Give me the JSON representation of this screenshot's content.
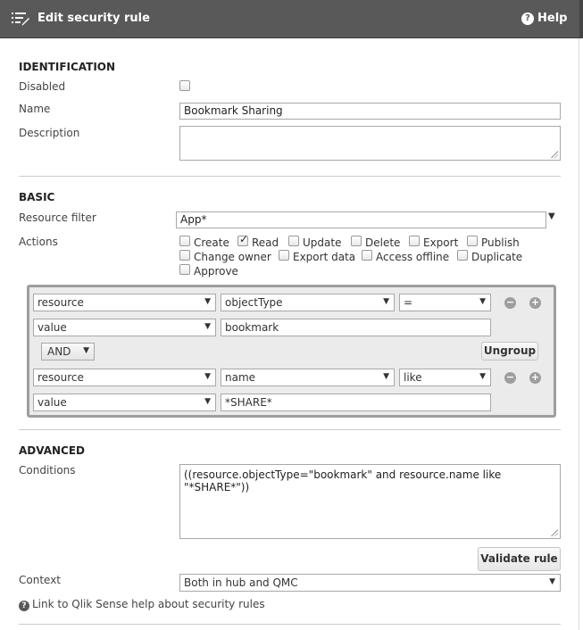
{
  "header": {
    "title": "Edit security rule",
    "help_label": "Help"
  },
  "identification": {
    "section_title": "IDENTIFICATION",
    "disabled_label": "Disabled",
    "name_label": "Name",
    "name_value": "Bookmark Sharing",
    "description_label": "Description",
    "description_value": ""
  },
  "basic": {
    "section_title": "BASIC",
    "resource_filter_label": "Resource filter",
    "resource_filter_value": "App*",
    "actions_label": "Actions",
    "actions": [
      {
        "label": "Create",
        "checked": false
      },
      {
        "label": "Read",
        "checked": true
      },
      {
        "label": "Update",
        "checked": false
      },
      {
        "label": "Delete",
        "checked": false
      },
      {
        "label": "Export",
        "checked": false
      },
      {
        "label": "Publish",
        "checked": false
      },
      {
        "label": "Change owner",
        "checked": false
      },
      {
        "label": "Export data",
        "checked": false
      },
      {
        "label": "Access offline",
        "checked": false
      },
      {
        "label": "Duplicate",
        "checked": false
      },
      {
        "label": "Approve",
        "checked": false
      }
    ]
  },
  "rule_builder": {
    "group1": {
      "field": "resource",
      "property": "objectType",
      "operator": "=",
      "value_type": "value",
      "value": "bookmark"
    },
    "join_operator": "AND",
    "ungroup_label": "Ungroup",
    "group2": {
      "field": "resource",
      "property": "name",
      "operator": "like",
      "value_type": "value",
      "value": "*SHARE*"
    },
    "remove_symbol": "−",
    "add_symbol": "+"
  },
  "advanced": {
    "section_title": "ADVANCED",
    "conditions_label": "Conditions",
    "conditions_value": "((resource.objectType=\"bookmark\" and resource.name like \"*SHARE*\"))",
    "validate_label": "Validate rule",
    "context_label": "Context",
    "context_value": "Both in hub and QMC",
    "help_link": "Link to Qlik Sense help about security rules"
  }
}
